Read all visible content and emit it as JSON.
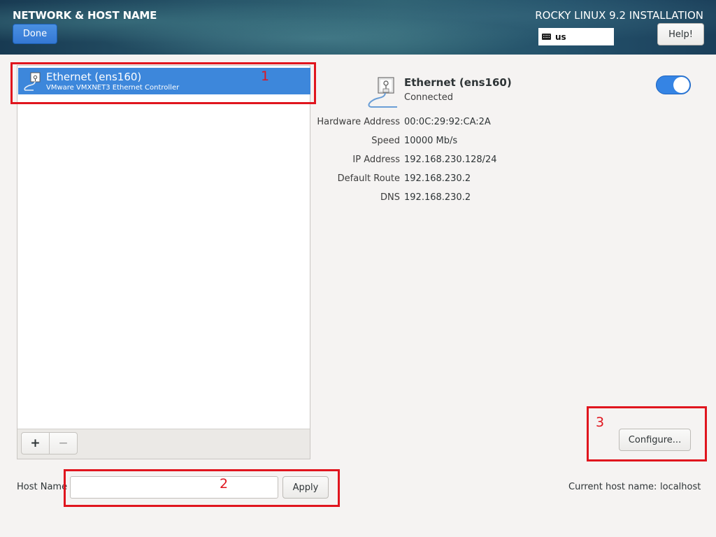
{
  "header": {
    "title": "NETWORK & HOST NAME",
    "done_label": "Done",
    "product": "ROCKY LINUX 9.2 INSTALLATION",
    "keyboard_layout": "us",
    "help_label": "Help!"
  },
  "devices": [
    {
      "name": "Ethernet (ens160)",
      "description": "VMware VMXNET3 Ethernet Controller",
      "selected": true
    }
  ],
  "device_toolbar": {
    "add_label": "+",
    "remove_label": "−"
  },
  "detail": {
    "name": "Ethernet (ens160)",
    "status": "Connected",
    "enabled": true,
    "properties": [
      {
        "label": "Hardware Address",
        "value": "00:0C:29:92:CA:2A"
      },
      {
        "label": "Speed",
        "value": "10000 Mb/s"
      },
      {
        "label": "IP Address",
        "value": "192.168.230.128/24"
      },
      {
        "label": "Default Route",
        "value": "192.168.230.2"
      },
      {
        "label": "DNS",
        "value": "192.168.230.2"
      }
    ],
    "configure_label": "Configure..."
  },
  "hostname": {
    "label": "Host Name",
    "value": "",
    "apply_label": "Apply",
    "current_label": "Current host name:",
    "current_value": "localhost"
  },
  "annotations": [
    "1",
    "2",
    "3"
  ],
  "colors": {
    "accent": "#3584e4",
    "selection": "#3d87db",
    "annotation": "#e0151e"
  }
}
